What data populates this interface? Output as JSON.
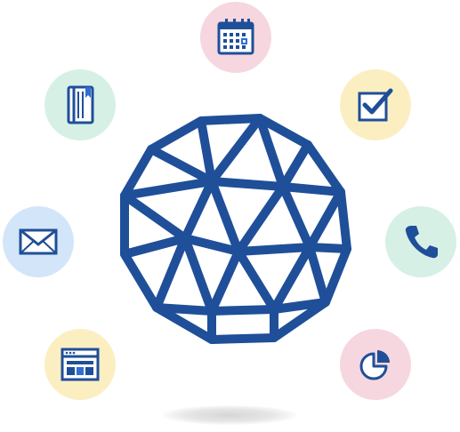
{
  "colors": {
    "stroke": "#1f4f99",
    "accent_blue": "#2f6fd0",
    "calendar_bg": "#f6d7df",
    "notebook_bg": "#d6f0e6",
    "checkbox_bg": "#fbefc2",
    "mail_bg": "#d3e5f9",
    "phone_bg": "#d6f0e6",
    "browser_bg": "#fbefc2",
    "piechart_bg": "#f6d7df"
  },
  "icons": [
    {
      "name": "calendar-icon"
    },
    {
      "name": "notebook-icon"
    },
    {
      "name": "checkbox-icon"
    },
    {
      "name": "mail-icon"
    },
    {
      "name": "phone-icon"
    },
    {
      "name": "browser-window-icon"
    },
    {
      "name": "pie-chart-icon"
    }
  ],
  "center": {
    "name": "geodesic-globe-icon"
  }
}
